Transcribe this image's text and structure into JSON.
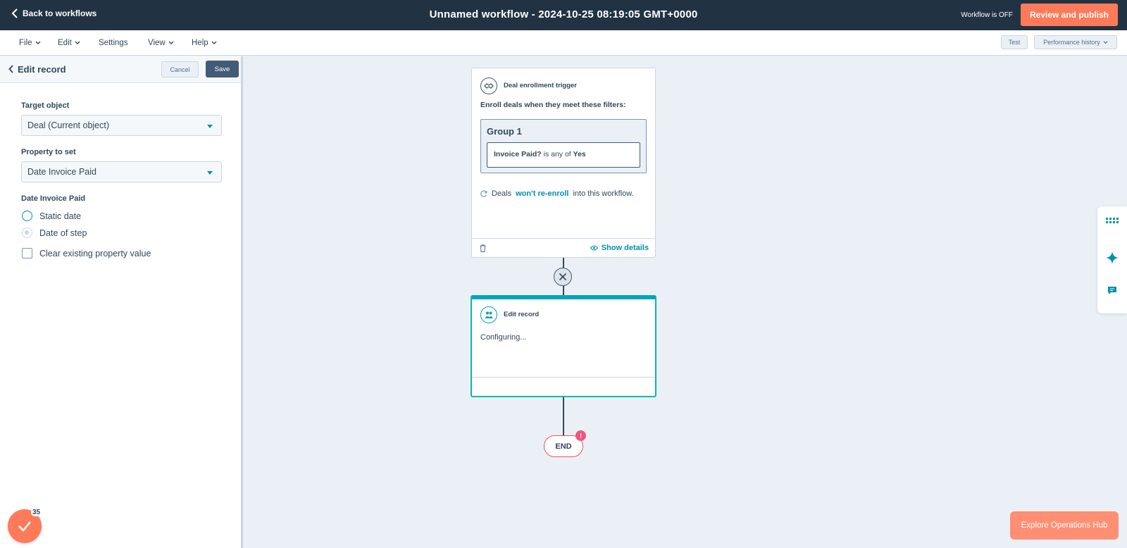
{
  "topbar": {
    "back_label": "Back to workflows",
    "title": "Unnamed workflow - 2024-10-25 08:19:05 GMT+0000",
    "status": "Workflow is OFF",
    "publish_label": "Review and publish"
  },
  "menu": {
    "items": [
      {
        "label": "File",
        "has_dropdown": true
      },
      {
        "label": "Edit",
        "has_dropdown": true
      },
      {
        "label": "Settings",
        "has_dropdown": false
      },
      {
        "label": "View",
        "has_dropdown": true
      },
      {
        "label": "Help",
        "has_dropdown": true
      }
    ],
    "test_label": "Test",
    "perf_label": "Performance history"
  },
  "panel": {
    "title": "Edit record",
    "cancel_label": "Cancel",
    "save_label": "Save",
    "target_object_label": "Target object",
    "target_object_value": "Deal (Current object)",
    "property_label": "Property to set",
    "property_value": "Date Invoice Paid",
    "date_section_label": "Date Invoice Paid",
    "radio_options": [
      "Static date",
      "Date of step"
    ],
    "clear_label": "Clear existing property value"
  },
  "trigger_card": {
    "heading": "Deal enrollment trigger",
    "enroll_text": "Enroll deals when they meet these filters:",
    "group_title": "Group 1",
    "filter_property": "Invoice Paid?",
    "filter_operator": "is any of",
    "filter_value": "Yes",
    "reenroll_prefix": "Deals",
    "reenroll_link": "won't re-enroll",
    "reenroll_suffix": "into this workflow.",
    "show_details": "Show details"
  },
  "action_card": {
    "heading": "Edit record",
    "status": "Configuring..."
  },
  "end_node": {
    "label": "END",
    "badge": "!"
  },
  "fab": {
    "count": "35"
  },
  "explore_label": "Explore Operations Hub",
  "colors": {
    "topbar": "#213343",
    "accent": "#ff7a59",
    "link": "#0091ae",
    "teal": "#00bda5",
    "canvas": "#eaf0f6"
  }
}
